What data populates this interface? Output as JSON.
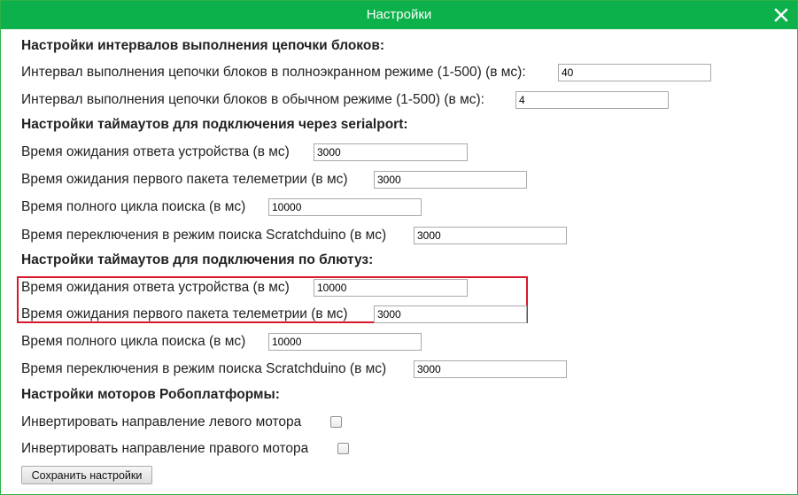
{
  "dialog": {
    "title": "Настройки"
  },
  "sections": {
    "interval": {
      "heading": "Настройки интервалов выполнения цепочки блоков:",
      "fullscreen_label": "Интервал выполнения цепочки блоков в полноэкранном режиме (1-500) (в мс):",
      "fullscreen_value": "40",
      "normal_label": "Интервал выполнения цепочки блоков в обычном режиме (1-500) (в мс):",
      "normal_value": "4"
    },
    "serial": {
      "heading": "Настройки таймаутов для подключения через serialport:",
      "response_label": "Время ожидания ответа устройства (в мс)",
      "response_value": "3000",
      "telemetry_label": "Время ожидания первого пакета телеметрии (в мс)",
      "telemetry_value": "3000",
      "search_cycle_label": "Время полного цикла поиска (в мс)",
      "search_cycle_value": "10000",
      "switch_label": "Время переключения в режим поиска Scratchduino (в мс)",
      "switch_value": "3000"
    },
    "bluetooth": {
      "heading": "Настройки таймаутов для подключения по блютуз:",
      "response_label": "Время ожидания ответа устройства (в мс)",
      "response_value": "10000",
      "telemetry_label": "Время ожидания первого пакета телеметрии (в мс)",
      "telemetry_value": "3000",
      "search_cycle_label": "Время полного цикла поиска (в мс)",
      "search_cycle_value": "10000",
      "switch_label": "Время переключения в режим поиска Scratchduino (в мс)",
      "switch_value": "3000"
    },
    "motors": {
      "heading": "Настройки моторов Робоплатформы:",
      "invert_left_label": "Инвертировать направление левого мотора",
      "invert_left_checked": false,
      "invert_right_label": "Инвертировать направление правого мотора",
      "invert_right_checked": false
    }
  },
  "save_button": "Сохранить настройки",
  "colors": {
    "titlebar": "#0db14b",
    "highlight": "#d8182b"
  }
}
